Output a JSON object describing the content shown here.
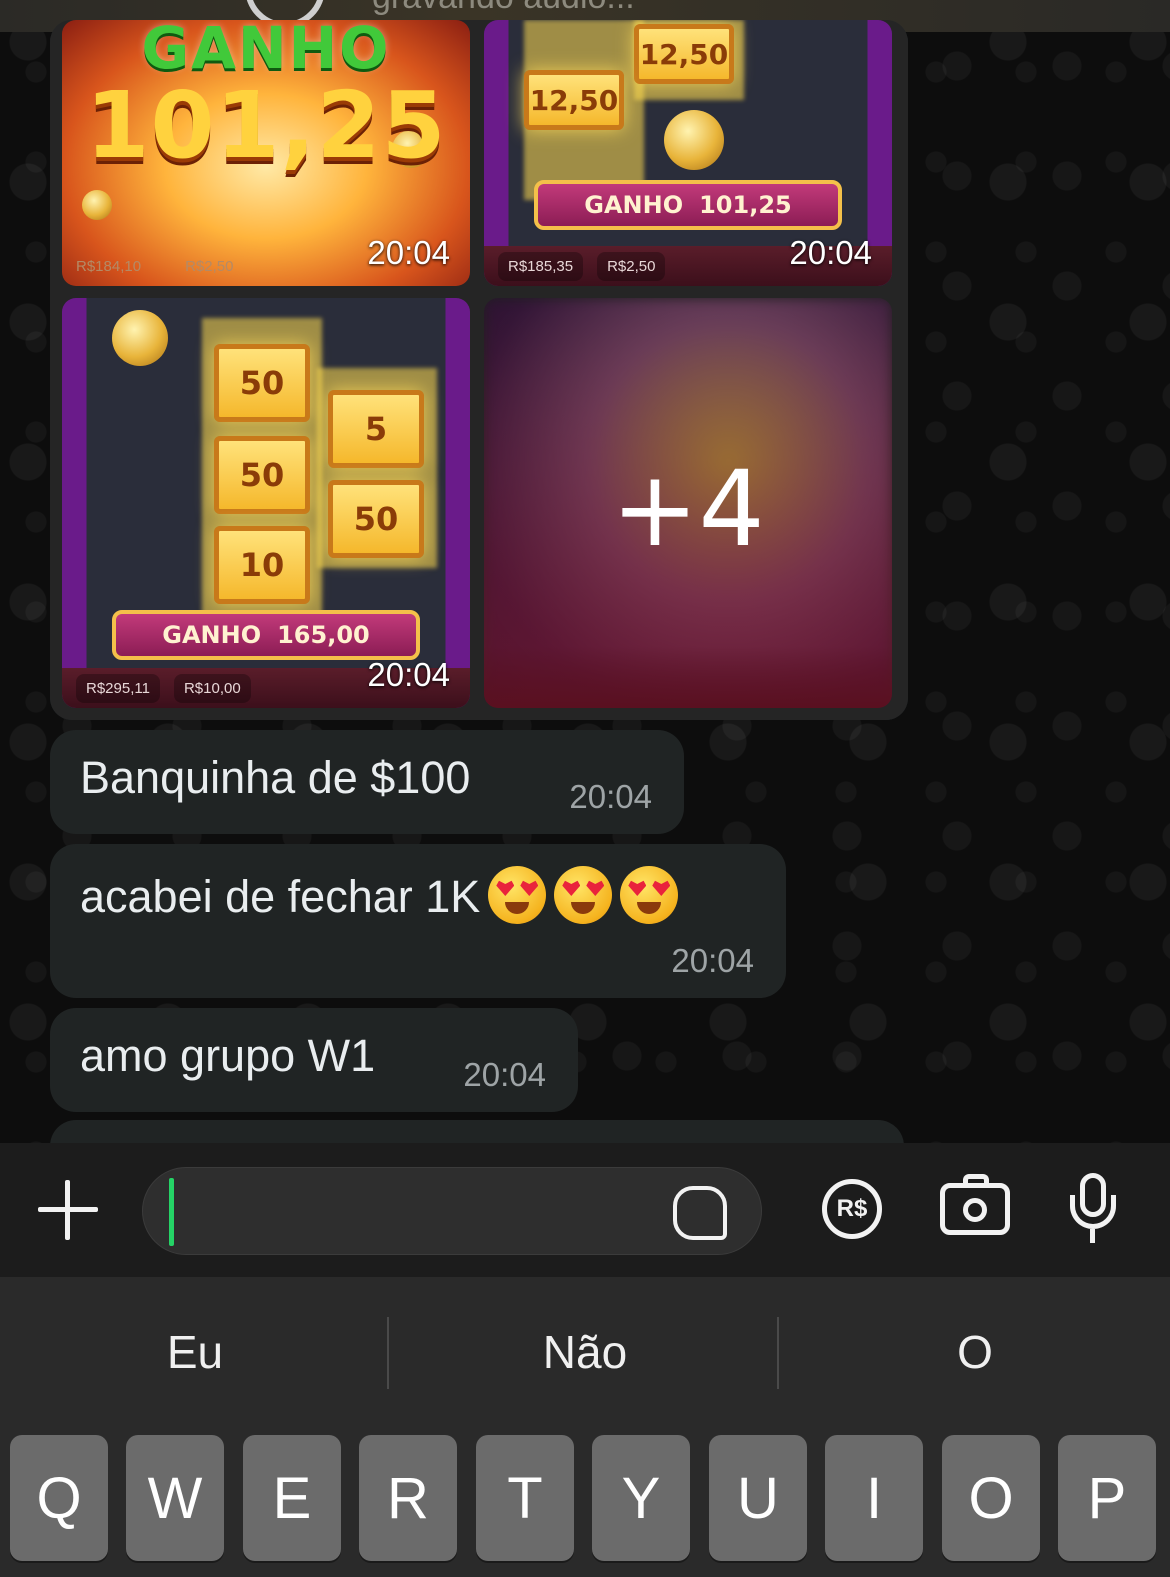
{
  "top": {
    "status_text": "gravando áudio..."
  },
  "album": {
    "tiles": [
      {
        "title": "GANHO",
        "amount": "101,25",
        "bar_left": "R$184,10",
        "bar_right": "R$2,50",
        "time": "20:04"
      },
      {
        "symbols": [
          "12,50",
          "12,50"
        ],
        "win_label": "GANHO",
        "win_amount": "101,25",
        "bar_left": "R$185,35",
        "bar_right": "R$2,50",
        "time": "20:04"
      },
      {
        "symbols": [
          "50",
          "50",
          "10",
          "5",
          "50"
        ],
        "win_label": "GANHO",
        "win_amount": "165,00",
        "bar_left": "R$295,11",
        "bar_right": "R$10,00",
        "time": "20:04"
      },
      {
        "more_count": "+4"
      }
    ]
  },
  "messages": [
    {
      "text": "Banquinha de $100",
      "time": "20:04"
    },
    {
      "text": "acabei de fechar 1K",
      "emoji_count": 3,
      "emoji_name": "heart-eyes-emoji",
      "time": "20:04"
    },
    {
      "text": "amo grupo W1",
      "time": "20:04"
    }
  ],
  "compose": {
    "placeholder": "",
    "icons": [
      "plus-icon",
      "sticker-icon",
      "payment-rs-icon",
      "camera-icon",
      "microphone-icon"
    ],
    "payment_label": "R$"
  },
  "keyboard": {
    "suggestions": [
      "Eu",
      "Não",
      "O"
    ],
    "row1": [
      "Q",
      "W",
      "E",
      "R",
      "T",
      "Y",
      "U",
      "I",
      "O",
      "P"
    ]
  },
  "colors": {
    "accent": "#25d366",
    "bubble": "#202424",
    "keyboard": "#2a2a2a",
    "key": "#6b6b6b"
  }
}
